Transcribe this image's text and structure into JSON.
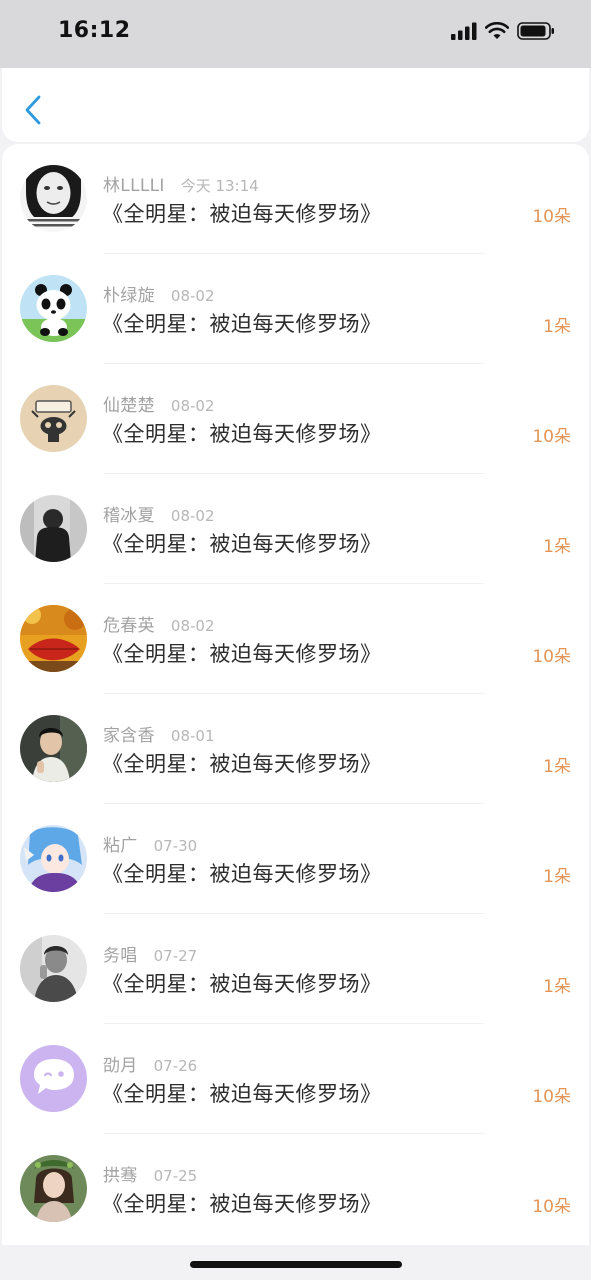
{
  "status_bar": {
    "time": "16:12"
  },
  "nav": {
    "back_icon": "chevron-left-icon",
    "accent_color": "#2d9ae0"
  },
  "list": {
    "items": [
      {
        "username": "林LLLLI",
        "time": "今天 13:14",
        "title": "《全明星：被迫每天修罗场》",
        "count": "10朵",
        "avatar": "meme-face-avatar"
      },
      {
        "username": "朴绿旋",
        "time": "08-02",
        "title": "《全明星：被迫每天修罗场》",
        "count": "1朵",
        "avatar": "panda-avatar"
      },
      {
        "username": "仙楚楚",
        "time": "08-02",
        "title": "《全明星：被迫每天修罗场》",
        "count": "10朵",
        "avatar": "sketch-avatar"
      },
      {
        "username": "稽冰夏",
        "time": "08-02",
        "title": "《全明星：被迫每天修罗场》",
        "count": "1朵",
        "avatar": "dark-figure-avatar"
      },
      {
        "username": "危春英",
        "time": "08-02",
        "title": "《全明星：被迫每天修罗场》",
        "count": "10朵",
        "avatar": "autumn-leaf-avatar"
      },
      {
        "username": "家含香",
        "time": "08-01",
        "title": "《全明星：被迫每天修罗场》",
        "count": "1朵",
        "avatar": "portrait-avatar"
      },
      {
        "username": "粘广",
        "time": "07-30",
        "title": "《全明星：被迫每天修罗场》",
        "count": "1朵",
        "avatar": "anime-avatar"
      },
      {
        "username": "务唱",
        "time": "07-27",
        "title": "《全明星：被迫每天修罗场》",
        "count": "1朵",
        "avatar": "monochrome-avatar"
      },
      {
        "username": "劭月",
        "time": "07-26",
        "title": "《全明星：被迫每天修罗场》",
        "count": "10朵",
        "avatar": "chat-bubble-avatar"
      },
      {
        "username": "拱骞",
        "time": "07-25",
        "title": "《全明星：被迫每天修罗场》",
        "count": "10朵",
        "avatar": "woman-portrait-avatar"
      }
    ]
  },
  "colors": {
    "count": "#e39557",
    "username": "#a3a3a3",
    "title": "#2d2d2d"
  }
}
